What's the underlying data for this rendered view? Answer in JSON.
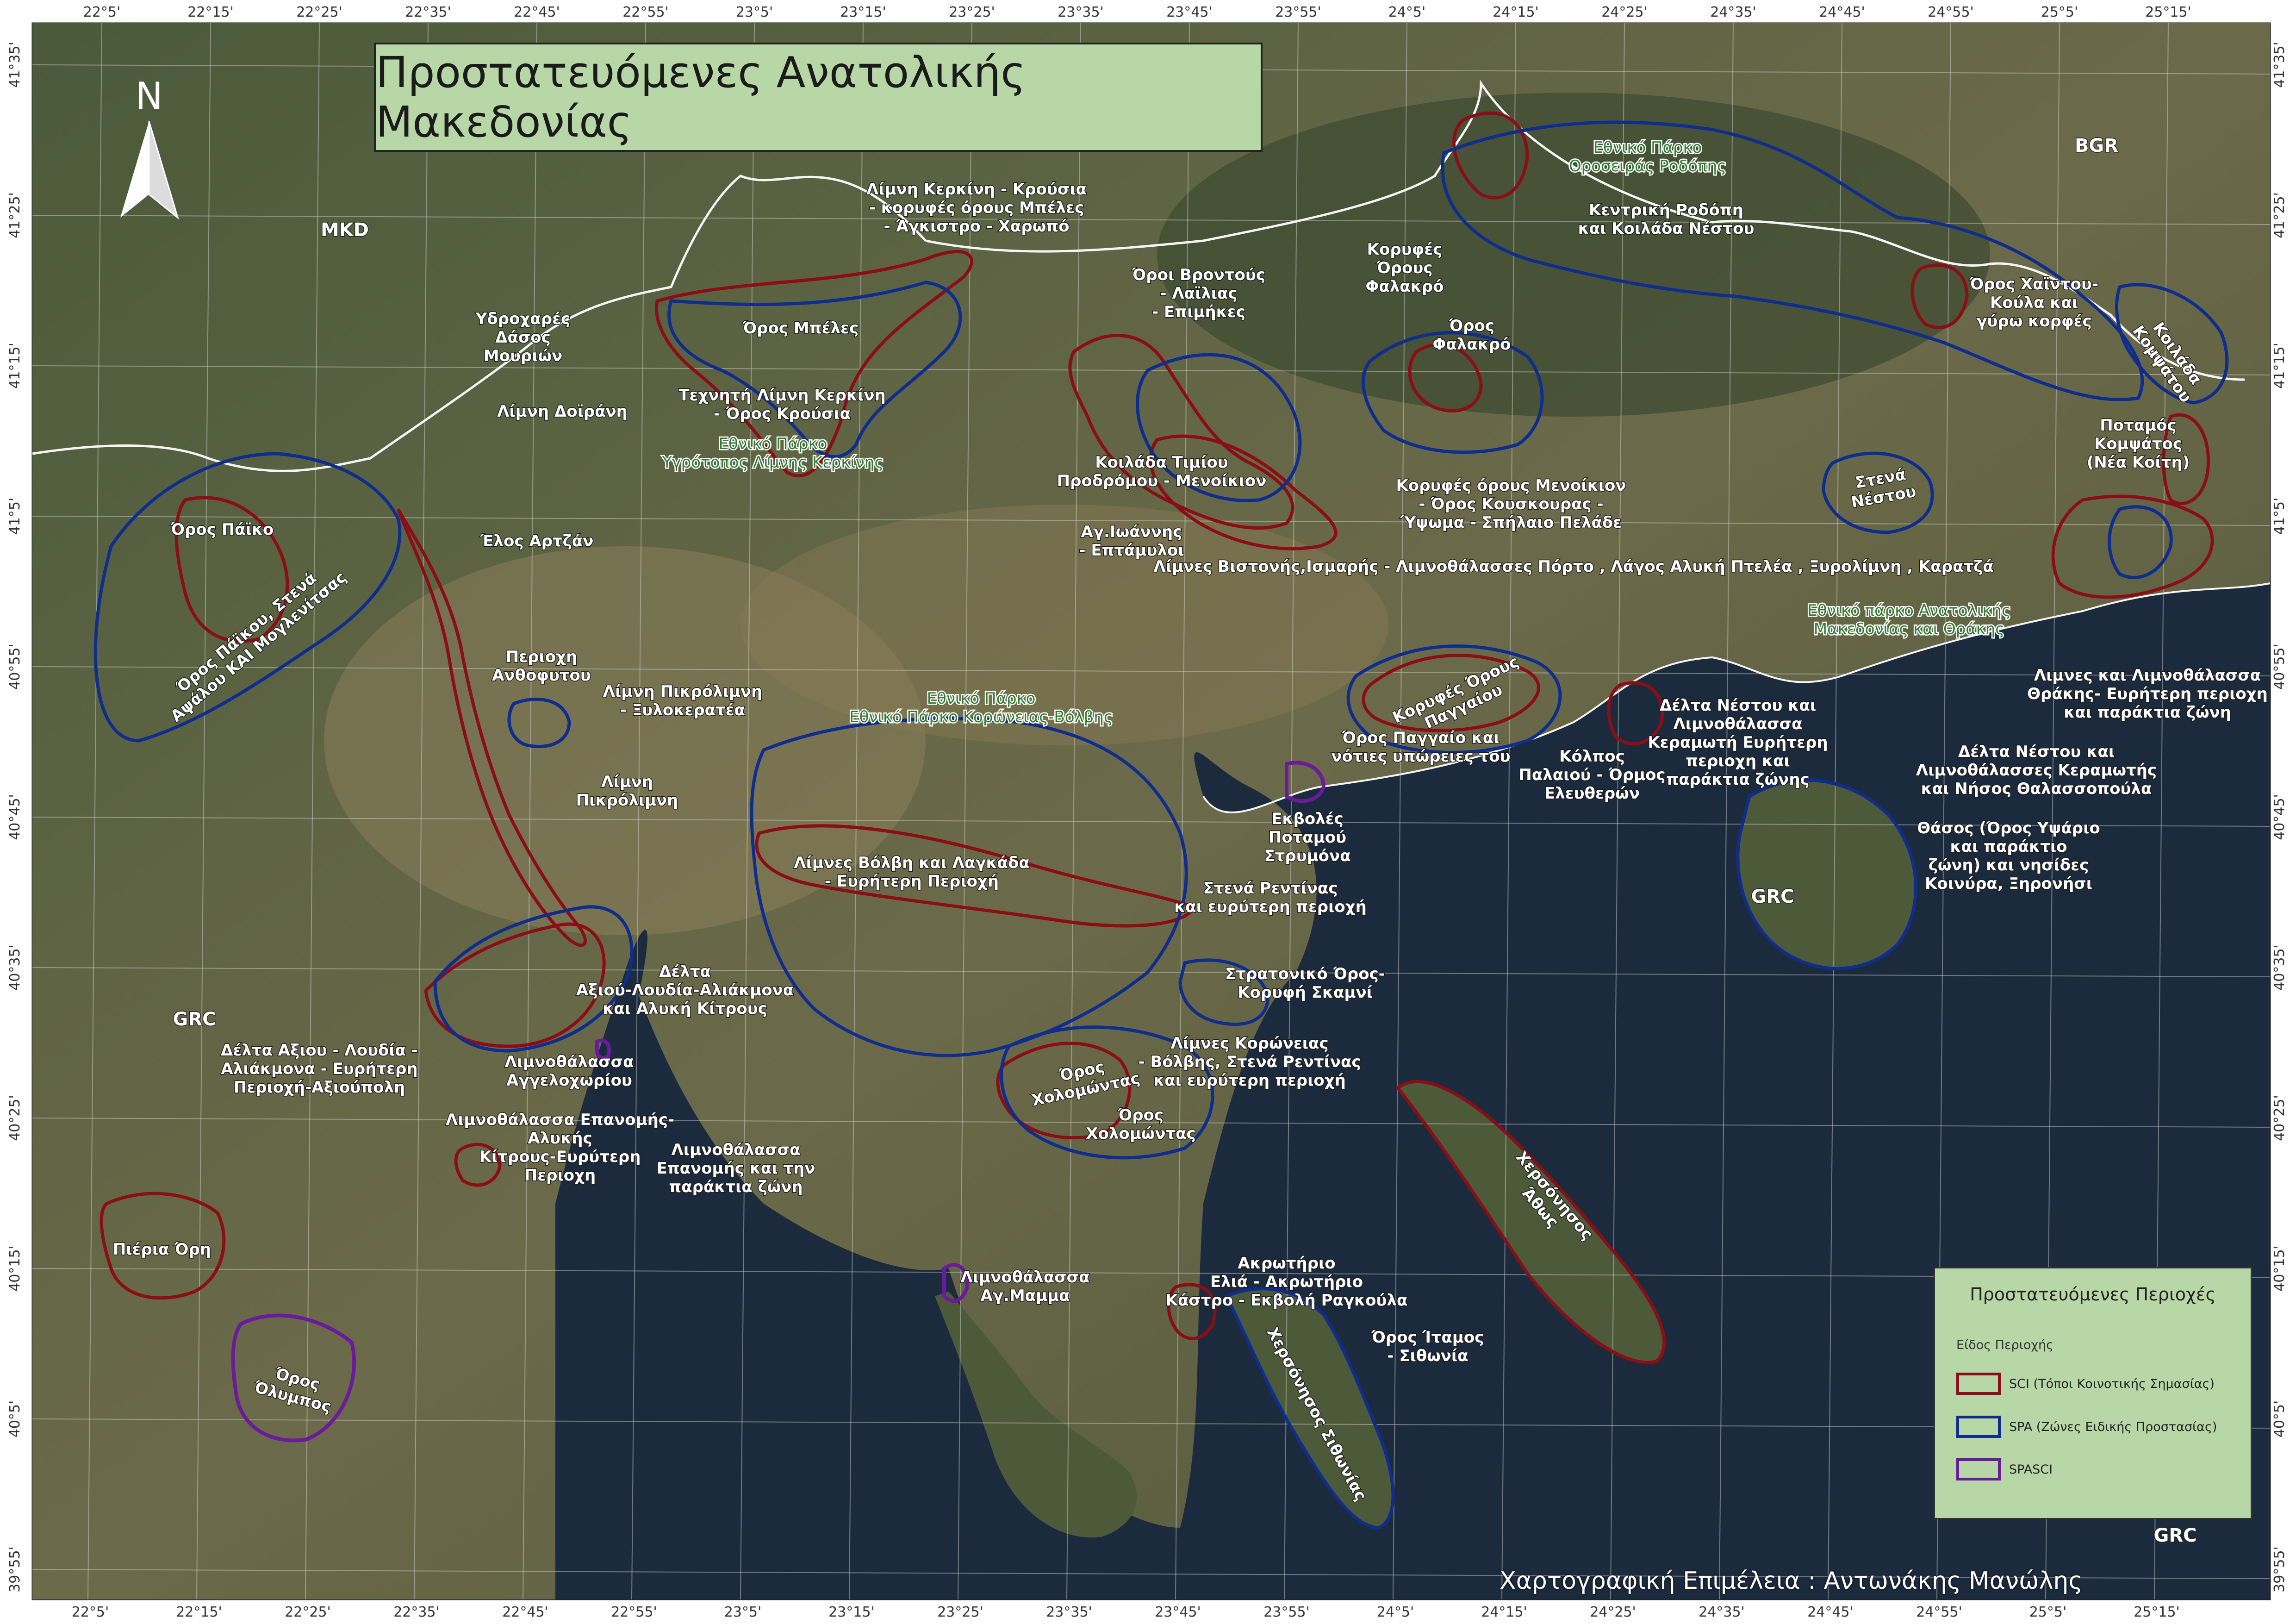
{
  "title": "Προστατευόμενες Ανατολικής Μακεδονίας",
  "north_arrow": {
    "label": "N",
    "icon": "north-arrow-icon"
  },
  "credit": "Χαρτογραφική Επιμέλεια : Αντωνάκης Μανώλης",
  "legend": {
    "title": "Προστατευόμενες Περιοχές",
    "subtitle": "Είδος Περιοχής",
    "items": [
      {
        "label": "SCI (Τόποι Κοινοτικής Σημασίας)",
        "color": "#8b0d16"
      },
      {
        "label": "SPA (Ζώνες Ειδικής Προστασίας)",
        "color": "#0e2d8c"
      },
      {
        "label": "SPASCI",
        "color": "#6a1b9a"
      }
    ]
  },
  "grid": {
    "top_lon": [
      "22°5'",
      "22°15'",
      "22°25'",
      "22°35'",
      "22°45'",
      "22°55'",
      "23°5'",
      "23°15'",
      "23°25'",
      "23°35'",
      "23°45'",
      "23°55'",
      "24°5'",
      "24°15'",
      "24°25'",
      "24°35'",
      "24°45'",
      "24°55'",
      "25°5'",
      "25°15'"
    ],
    "bottom_lon": [
      "22°5'",
      "22°15'",
      "22°25'",
      "22°35'",
      "22°45'",
      "22°55'",
      "23°5'",
      "23°15'",
      "23°25'",
      "23°35'",
      "23°45'",
      "23°55'",
      "24°5'",
      "24°15'",
      "24°25'",
      "24°35'",
      "24°45'",
      "24°55'",
      "25°5'",
      "25°15'"
    ],
    "lat": [
      "41°35'",
      "41°25'",
      "41°15'",
      "41°5'",
      "40°55'",
      "40°45'",
      "40°35'",
      "40°25'",
      "40°15'",
      "40°5'",
      "39°55'"
    ]
  },
  "countries": {
    "mkd": "MKD",
    "bgr": "BGR",
    "grc_west": "GRC",
    "grc_thasos": "GRC",
    "bottom_right": "GRC"
  },
  "labels": {
    "kerkini_krousia": [
      "Λίμνη Κερκίνη - Κρούσια",
      "- κορυφές όρους Μπέλες",
      "- Άγκιστρο - Χαρωπό"
    ],
    "ydroxares": [
      "Υδροχαρές",
      "Δάσος",
      "Μουριών"
    ],
    "oros_beles": [
      "Όρος Μπέλες"
    ],
    "texniti_kerkini": [
      "Τεχνητή Λίμνη Κερκίνη",
      "- Όρος Κρούσια"
    ],
    "doirani": [
      "Λίμνη Δοϊράνη"
    ],
    "np_kerkini": [
      "Εθνικό Πάρκο",
      "Υγρότοπος Λίμνης Κερκίνης"
    ],
    "vrontous": [
      "Όροι Βροντούς",
      "- Λαϊλιας",
      "- Επιμήκες"
    ],
    "tim_prodromou": [
      "Κοιλάδα Τιμίου",
      "Προδρόμου - Μενοίκιον"
    ],
    "ag_ioannis": [
      "Αγ.Ιωάννης",
      "- Επτάμυλοι"
    ],
    "np_orosirias": [
      "Εθνικό Πάρκο",
      "Οροσειράς Ροδόπης"
    ],
    "kentriki_rodopi": [
      "Κεντρική Ροδόπη",
      "και Κοιλάδα Νέστου"
    ],
    "korifes_falakro": [
      "Κορυφές",
      "Όρους",
      "Φαλακρό"
    ],
    "oros_falakro": [
      "Όρος",
      "Φαλακρό"
    ],
    "menoikion": [
      "Κορυφές όρους Μενοίκιον",
      "- Όρος Κουσκουρας -",
      "Ύψωμα - Σπήλαιο Πελάδε"
    ],
    "xaintou": [
      "Όρος Χαϊντου-",
      "Κούλα και",
      "γύρω κορφές"
    ],
    "koilada_kompsatou": [
      "Κοιλάδα",
      "Κομψάτου"
    ],
    "potamos_kompsatos": [
      "Ποταμός",
      "Κομψάτος",
      "(Νέα Κοίτη)"
    ],
    "stena_nestou": [
      "Στενά",
      "Νέστου"
    ],
    "vistonidas": [
      "Λίμνες Βιστονής,Ισμαρής - Λιμνοθάλασσες Πόρτο , Λάγος Αλυκή Πτελέα , Ξυρολίμνη , Καρατζά"
    ],
    "np_am_thrakis": [
      "Εθνικό πάρκο Ανατολικής",
      "Μακεδονίας και Θράκης"
    ],
    "limnes_thrakis": [
      "Λιμνες και Λιμνοθάλασσα",
      "Θράκης- Ευρήτερη περιοχη",
      "και παράκτια ζώνη"
    ],
    "delta_nestou_kramoti": [
      "Δέλτα Νέστου και",
      "Λιμνοθάλασσα",
      "Κεραμωτή Ευρήτερη",
      "περιοχη και",
      "παράκτια ζώνης"
    ],
    "delta_nestou_thalasso": [
      "Δέλτα Νέστου και",
      "Λιμνοθάλασσες Κεραμωτής",
      "και Νήσος Θαλασσοπούλα"
    ],
    "thasos": [
      "Θάσος (Όρος Υψάριο",
      "και παράκτιο",
      "ζώνη) και νησίδες",
      "Κοινύρα, Ξηρονήσι"
    ],
    "korifes_paggaiou": [
      "Κορυφές Όρους",
      "Παγγαίου"
    ],
    "oros_paggaio": [
      "Όρος Παγγαίο και",
      "νότιες υπώρειες του"
    ],
    "kolpos_paleou": [
      "Κόλπος",
      "Παλαιού - Όρμος",
      "Ελευθερών"
    ],
    "oros_paiko": [
      "Όρος Πάϊκο"
    ],
    "paiko_stena": [
      "Όρος Πάϊκου, Στενά",
      "Αψάλου ΚΑΙ Μογλενίτσας"
    ],
    "elos_artzan": [
      "Έλος Αρτζάν"
    ],
    "anthofytou": [
      "Περιοχη",
      "Ανθοφυτου"
    ],
    "pikrolimni_ksylo": [
      "Λίμνη Πικρόλιμνη",
      "- Ξυλοκερατέα"
    ],
    "pikrolimni": [
      "Λίμνη",
      "Πικρόλιμνη"
    ],
    "np_koroneias": [
      "Εθνικό Πάρκο",
      "Εθνικό Πάρκο Κορώνειας-Βόλβης"
    ],
    "volvi_lagkada": [
      "Λίμνες Βόλβη και Λαγκάδα",
      "- Ευρήτερη Περιοχή"
    ],
    "ekvoles_strymona": [
      "Εκβολές",
      "Ποταμού",
      "Στρυμόνα"
    ],
    "stena_rentinas": [
      "Στενά Ρεντίνας",
      "και ευρύτερη περιοχή"
    ],
    "stratoniko": [
      "Στρατονικό Όρος-",
      "Κορυφή Σκαμνί"
    ],
    "limnes_koroneias": [
      "Λίμνες Κορώνειας",
      "- Βόλβης, Στενά Ρεντίνας",
      "και ευρύτερη περιοχή"
    ],
    "xolomontas_sci": [
      "Όρος",
      "Χολομώντας"
    ],
    "xolomontas_spa": [
      "Όρος",
      "Χολομώντας"
    ],
    "delta_aksiou": [
      "Δέλτα",
      "Αξιού-Λουδία-Αλιάκμονα",
      "και Αλυκή Κίτρους"
    ],
    "delta_aksiou_eur": [
      "Δέλτα Αξιου - Λουδία -",
      "Αλιάκμονα - Ευρήτερη",
      "Περιοχή-Αξιούπολη"
    ],
    "aggeloxoriou": [
      "Λιμνοθάλασσα",
      "Αγγελοχωρίου"
    ],
    "epanomis_alykis": [
      "Λιμνοθάλασσα Επανομής-",
      "Αλυκής",
      "Κίτρους-Ευρύτερη",
      "Περιοχη"
    ],
    "epanomis_paraktia": [
      "Λιμνοθάλασσα",
      "Επανομής και την",
      "παράκτια ζώνη"
    ],
    "pieria": [
      "Πιέρια Όρη"
    ],
    "olympos": [
      "Όρος",
      "Όλυμπος"
    ],
    "ag_mamma": [
      "Λιμνοθάλασσα",
      "Αγ.Μαμμα"
    ],
    "akrotirio_elia": [
      "Ακρωτήριο",
      "Ελιά - Ακρωτήριο",
      "Κάστρο - Εκβολή Ραγκούλα"
    ],
    "itamos": [
      "Όρος Ίταμος",
      "- Σιθωνία"
    ],
    "athos": [
      "Χερσόνησος",
      "Άθως"
    ],
    "sithonia": [
      "Χερσόνησος Σιθωνίας"
    ]
  }
}
